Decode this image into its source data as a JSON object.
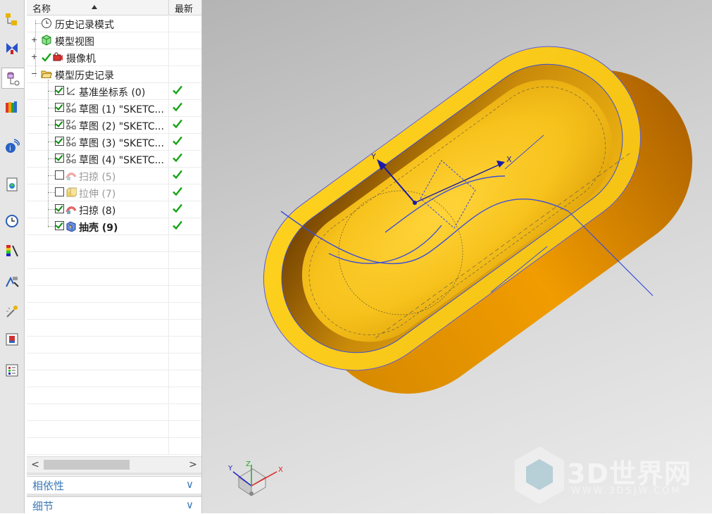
{
  "navigator": {
    "columns": {
      "name": "名称",
      "latest": "最新"
    },
    "tree": {
      "history_mode": "历史记录模式",
      "model_views": "模型视图",
      "cameras": "摄像机",
      "model_history": "模型历史记录",
      "features": [
        {
          "label": "基准坐标系 (0)",
          "checked": true,
          "latest": true,
          "style": "normal"
        },
        {
          "label": "草图 (1) \"SKETC...",
          "checked": true,
          "latest": true,
          "style": "normal"
        },
        {
          "label": "草图 (2) \"SKETC...",
          "checked": true,
          "latest": true,
          "style": "normal"
        },
        {
          "label": "草图 (3) \"SKETC...",
          "checked": true,
          "latest": true,
          "style": "normal"
        },
        {
          "label": "草图 (4) \"SKETC...",
          "checked": true,
          "latest": true,
          "style": "normal"
        },
        {
          "label": "扫掠 (5)",
          "checked": false,
          "latest": true,
          "style": "gray"
        },
        {
          "label": "拉伸 (7)",
          "checked": false,
          "latest": true,
          "style": "gray"
        },
        {
          "label": "扫掠 (8)",
          "checked": true,
          "latest": true,
          "style": "normal"
        },
        {
          "label": "抽壳 (9)",
          "checked": true,
          "latest": true,
          "style": "bold"
        }
      ]
    },
    "scroll_left": "<",
    "scroll_right": ">",
    "panels": {
      "dependencies": "相依性",
      "details": "细节",
      "chevron": "∨"
    }
  },
  "viewport": {
    "triad": {
      "x": "X",
      "y": "Y",
      "z": "Z"
    },
    "sketch_axis": {
      "x": "X",
      "y": "Y"
    },
    "watermark": {
      "main": "3D世界网",
      "sub": "WWW.3DSJW.COM"
    }
  },
  "colors": {
    "part_yellow": "#f7c21c",
    "part_inner": "#c88a06",
    "sketch_blue": "#3b4fd8",
    "check_green": "#15a315",
    "panel_title": "#3a79b8"
  }
}
